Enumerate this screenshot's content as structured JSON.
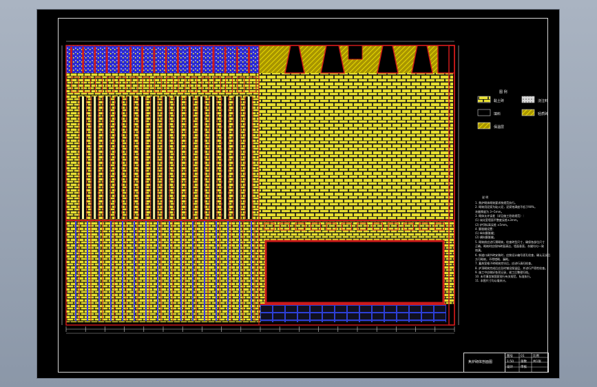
{
  "window": {
    "background": "#8f9aab",
    "sheet_color": "#000000"
  },
  "colors": {
    "brick": "#e8e030",
    "mortar": "#1a1a1a",
    "steel": "#cc1a1a",
    "glaze": "#3f3fe0",
    "frame": "#d8d8d8",
    "hatch": "#c8b400"
  },
  "legend": {
    "title": "图 例",
    "items": [
      {
        "label": "黏土砖",
        "swatch": "brick"
      },
      {
        "label": "浇注料",
        "swatch": "dots"
      },
      {
        "label": "填料",
        "swatch": "plain"
      },
      {
        "label": "轻质砖",
        "swatch": "hatch"
      },
      {
        "label": "保温层",
        "swatch": "hatch2"
      }
    ]
  },
  "notes": {
    "title": "说 明",
    "lines": [
      "1. 焦炉砌体砌筑要求按规范执行。",
      "2. 砌筑用泥浆为硅火泥，泥浆饱满度不低于90%，",
      "   灰缝厚度为 3~5mm。",
      "3. 砌体允许误差（详见施工验收规范）：",
      "   (1) 炭化室墙面平整度误差±3mm。",
      "   (2) 炉顶标高误差 ±5mm。",
      "4. 膨胀缝设置：",
      "   (1) 纵向膨胀缝；",
      "   (2) 横向膨胀缝。",
      "5. 砌筑前应进行预砌筑，检查砖型尺寸，确保各部位尺寸",
      "   正确。砌筑时应保持砖面清洁，墙面垂直，灰缝均匀一致",
      "   饱满。",
      "6. 斜道口调节砖安装时，应按设计编号逐孔检查，确认无误后",
      "   方可砌筑，不得错砌、漏砌。",
      "7. 蓄热室格子砖砌筑完毕后，应进行清扫检查。",
      "8. 炉顶砌筑完成后应及时铺设保温层，并进行严密性检查。",
      "9. 施工中应做好各项记录，竣工后整理归档。",
      "10. 未尽事宜按国家现行有关规范、标准执行。",
      "11. 本图尺寸均以毫米计。"
    ]
  },
  "title_block": {
    "drawing_name": "焦炉砌体剖面图",
    "cells": [
      "图号",
      "01",
      "比例",
      "1:50",
      "张数",
      "共1张",
      "设计",
      "审核"
    ]
  }
}
